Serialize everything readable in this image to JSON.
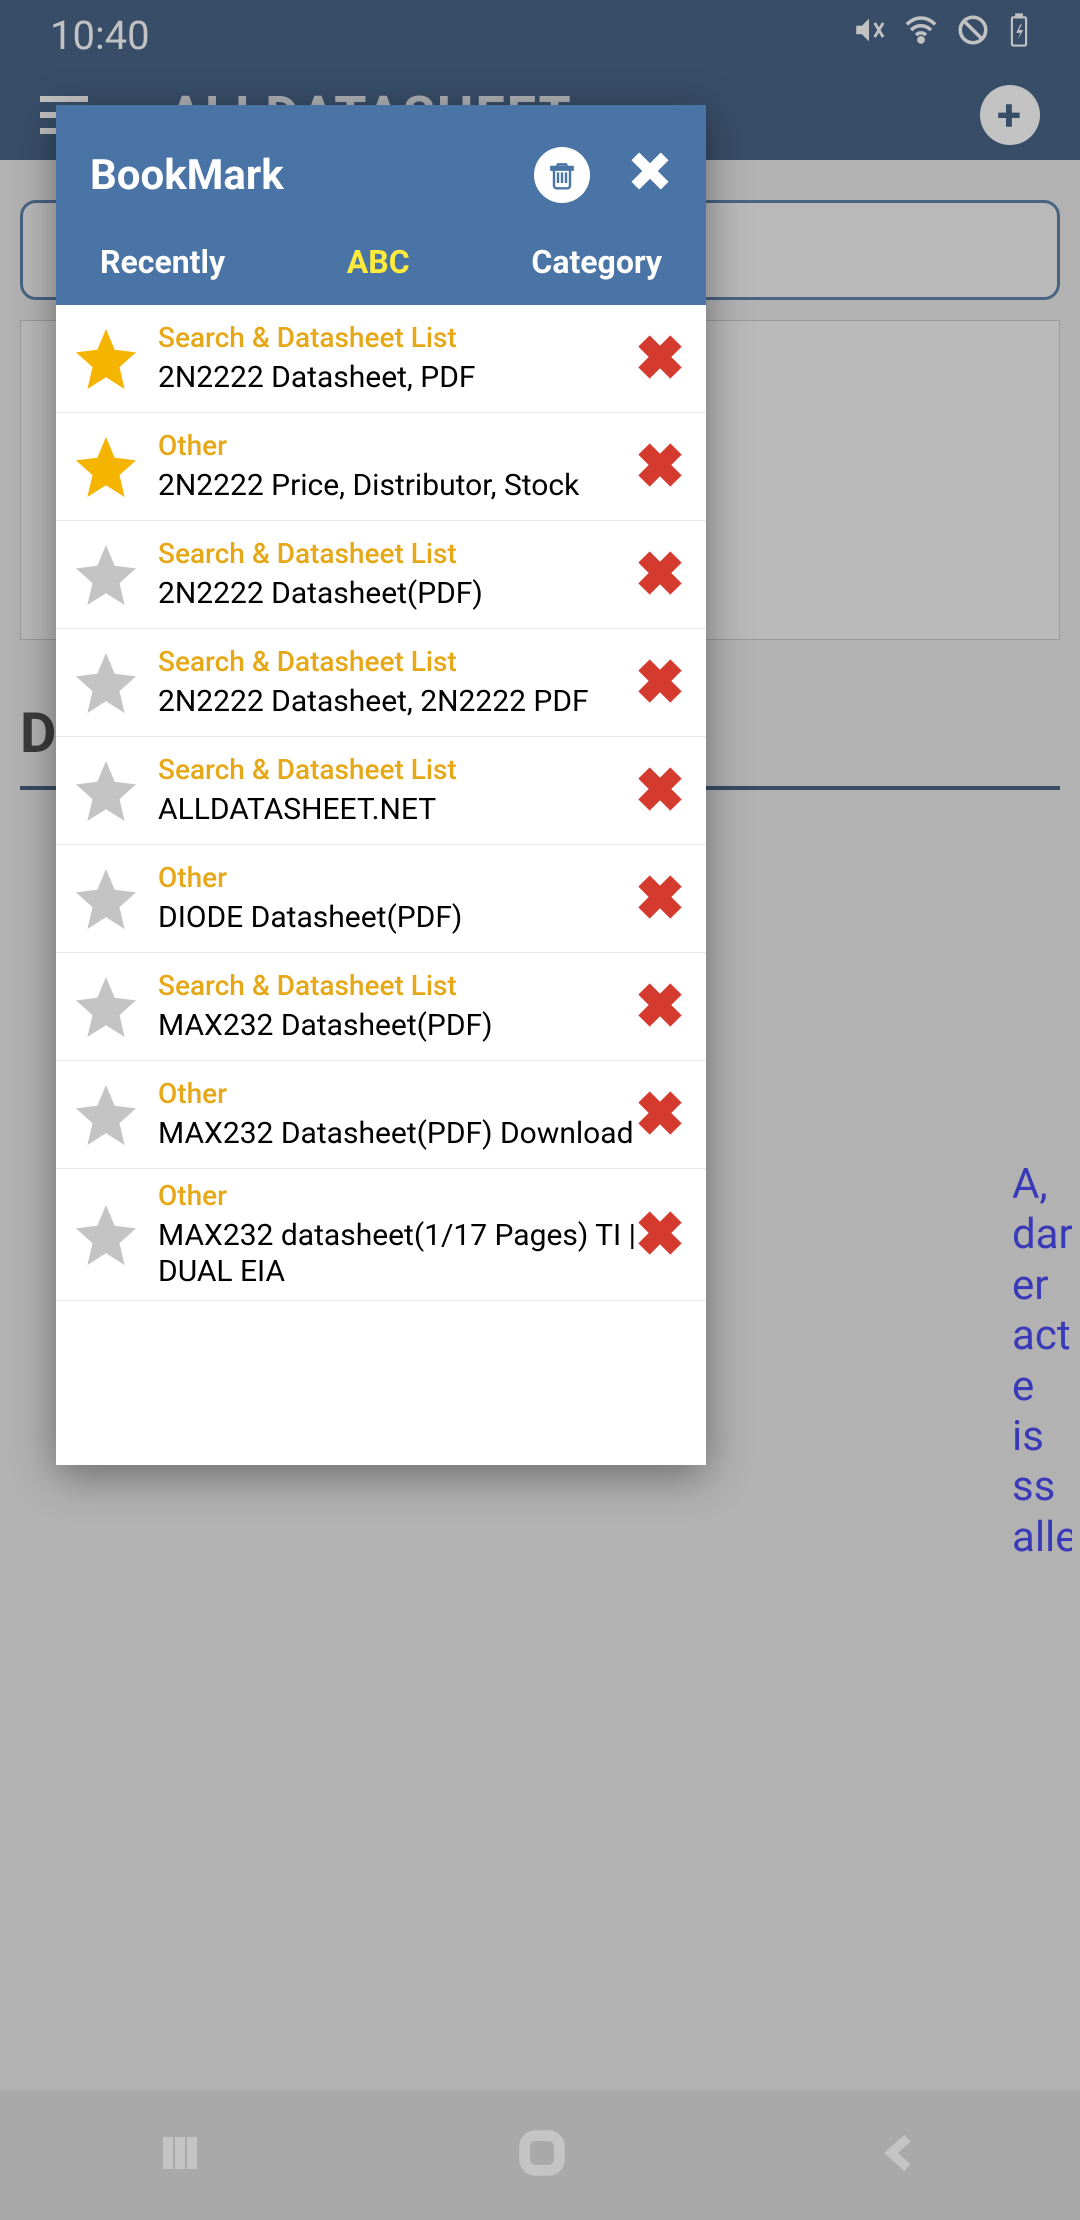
{
  "status": {
    "time": "10:40"
  },
  "app": {
    "title": "ALLDATASHEET"
  },
  "modal": {
    "title": "BookMark",
    "tabs": {
      "recently": "Recently",
      "abc": "ABC",
      "category": "Category",
      "active": "abc"
    },
    "items": [
      {
        "category": "Search & Datasheet List",
        "title": "2N2222 Datasheet, PDF",
        "starred": true
      },
      {
        "category": "Other",
        "title": "2N2222 Price, Distributor, Stock",
        "starred": true
      },
      {
        "category": "Search & Datasheet List",
        "title": "2N2222 Datasheet(PDF)",
        "starred": false
      },
      {
        "category": "Search & Datasheet List",
        "title": "2N2222 Datasheet, 2N2222 PDF",
        "starred": false
      },
      {
        "category": "Search & Datasheet List",
        "title": "ALLDATASHEET.NET",
        "starred": false
      },
      {
        "category": "Other",
        "title": "DIODE Datasheet(PDF)",
        "starred": false
      },
      {
        "category": "Search & Datasheet List",
        "title": "MAX232 Datasheet(PDF)",
        "starred": false
      },
      {
        "category": "Other",
        "title": "MAX232 Datasheet(PDF) Download",
        "starred": false
      },
      {
        "category": "Other",
        "title": "MAX232 datasheet(1/17 Pages) TI | DUAL EIA",
        "starred": false
      }
    ]
  }
}
